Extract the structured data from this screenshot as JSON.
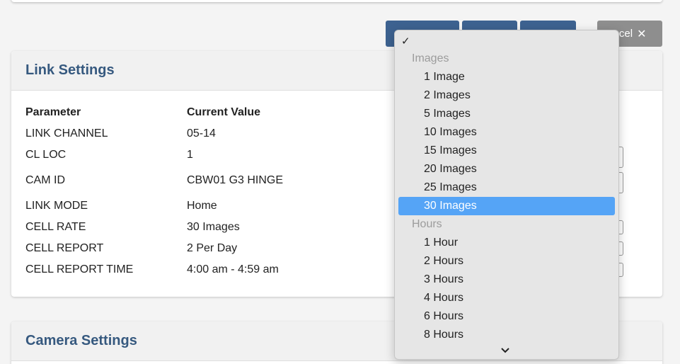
{
  "toolbar": {
    "cancel_label": "ncel",
    "cancel_icon": "close-icon",
    "primary_color": "#3d6290"
  },
  "link_settings": {
    "title": "Link Settings",
    "header_parameter": "Parameter",
    "header_value": "Current Value",
    "rows": [
      {
        "param": "LINK CHANNEL",
        "value": "05-14"
      },
      {
        "param": "CL LOC",
        "value": "1"
      },
      {
        "param": "CAM ID",
        "value": "CBW01 G3 HINGE"
      },
      {
        "param": "LINK MODE",
        "value": "Home"
      },
      {
        "param": "CELL RATE",
        "value": "30 Images"
      },
      {
        "param": "CELL REPORT",
        "value": "2 Per Day"
      },
      {
        "param": "CELL REPORT TIME",
        "value": "4:00 am - 4:59 am"
      }
    ]
  },
  "camera_settings": {
    "title": "Camera Settings"
  },
  "dropdown": {
    "check": "✓",
    "group_images": "Images",
    "images": [
      "1 Image",
      "2 Images",
      "5 Images",
      "10 Images",
      "15 Images",
      "20 Images",
      "25 Images"
    ],
    "selected": "30 Images",
    "group_hours": "Hours",
    "hours": [
      "1 Hour",
      "2 Hours",
      "3 Hours",
      "4 Hours",
      "6 Hours",
      "8 Hours"
    ],
    "more_icon": "chevron-down-icon",
    "highlight_color": "#55a4f6"
  }
}
